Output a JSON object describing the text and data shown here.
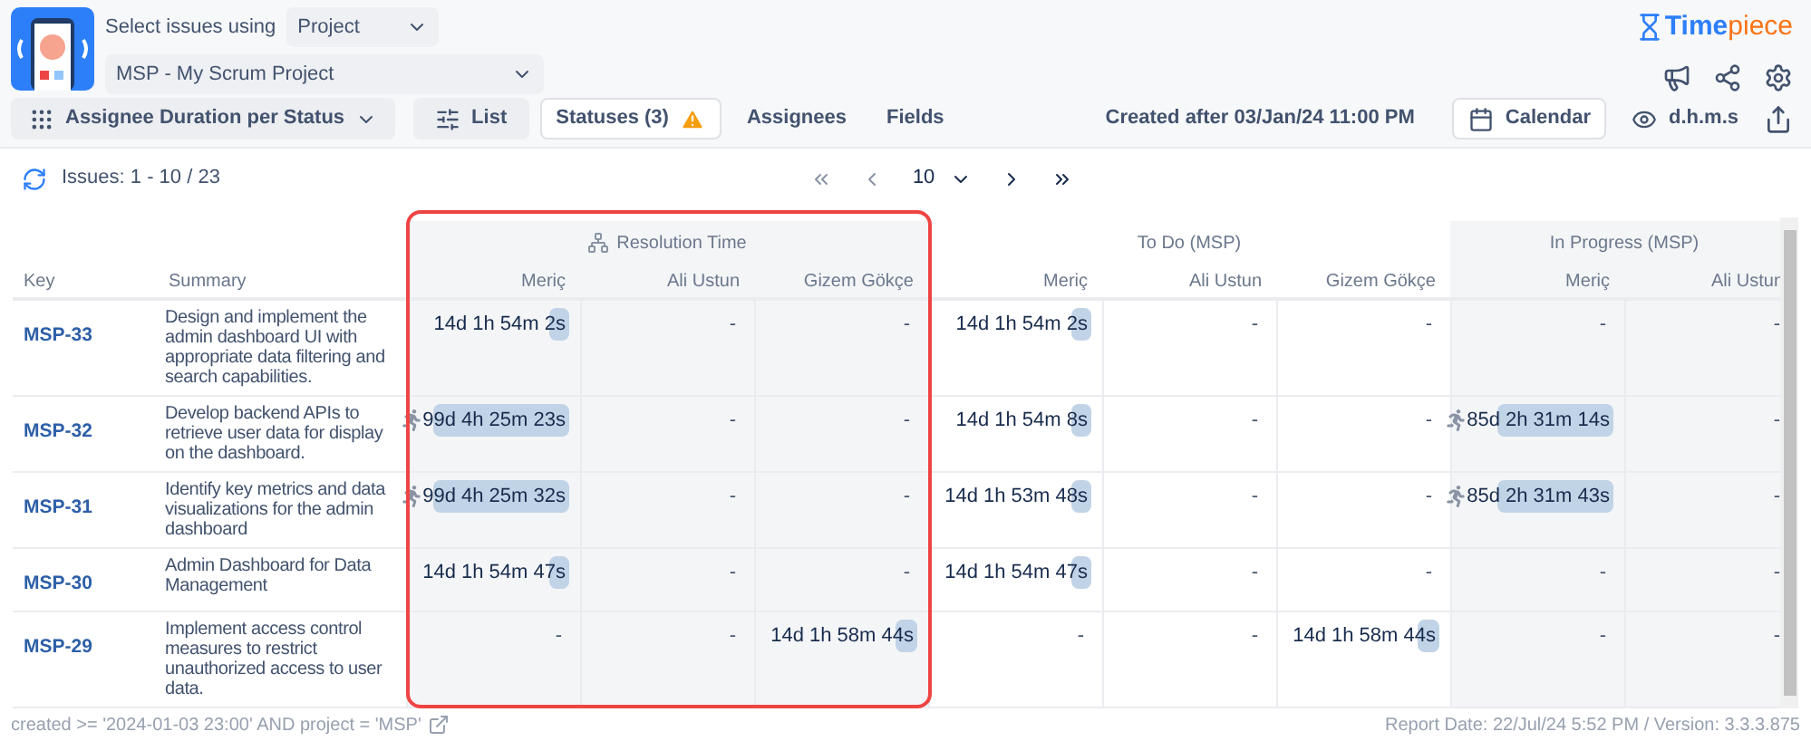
{
  "header": {
    "select_label": "Select issues using",
    "select_value": "Project",
    "project_value": "MSP - My Scrum Project",
    "brand": {
      "part_1": "Time",
      "part_2": "piece"
    }
  },
  "toolbar": {
    "report": "Assignee Duration per Status",
    "list": "List",
    "statuses": "Statuses (3)",
    "statuses_warning": true,
    "assignees": "Assignees",
    "fields": "Fields",
    "filter": "Created after 03/Jan/24 11:00 PM",
    "calendar": "Calendar",
    "format": "d.h.m.s"
  },
  "pager": {
    "issues": "Issues: 1 - 10 / 23",
    "page_size": "10"
  },
  "table": {
    "columns": [
      "Key",
      "Summary"
    ],
    "groups": [
      {
        "title": "Resolution Time",
        "kind": "aggregate",
        "highlighted": true,
        "assignees": [
          "Meriç",
          "Ali Ustun",
          "Gizem Gökçe"
        ]
      },
      {
        "title": "To Do (MSP)",
        "kind": "status",
        "highlighted": false,
        "assignees": [
          "Meriç",
          "Ali Ustun",
          "Gizem Gökçe"
        ]
      },
      {
        "title": "In Progress (MSP)",
        "kind": "status",
        "highlighted": false,
        "assignees": [
          "Meriç",
          "Ali Ustun"
        ]
      }
    ],
    "rows": [
      {
        "key": "MSP-33",
        "summary": "Design and implement the admin dashboard UI with appropriate data filtering and search capabilities.",
        "cells": [
          {
            "kind": "bar",
            "text": "14d 1h 54m 2s",
            "level": 0.13
          },
          {
            "kind": "plain",
            "text": "-"
          },
          {
            "kind": "plain",
            "text": "-"
          },
          {
            "kind": "bar",
            "text": "14d 1h 54m 2s",
            "level": 0.13
          },
          {
            "kind": "plain",
            "text": "-"
          },
          {
            "kind": "plain",
            "text": "-"
          },
          {
            "kind": "plain",
            "text": "-"
          },
          {
            "kind": "plain",
            "text": "-"
          }
        ]
      },
      {
        "key": "MSP-32",
        "summary": "Develop backend APIs to retrieve user data for display on the dashboard.",
        "cells": [
          {
            "kind": "runner",
            "text": "99d 4h 25m 23s",
            "level": 0.9
          },
          {
            "kind": "plain",
            "text": "-"
          },
          {
            "kind": "plain",
            "text": "-"
          },
          {
            "kind": "bar",
            "text": "14d 1h 54m 8s",
            "level": 0.13
          },
          {
            "kind": "plain",
            "text": "-"
          },
          {
            "kind": "plain",
            "text": "-"
          },
          {
            "kind": "runner",
            "text": "85d 2h 31m 14s",
            "level": 0.77
          },
          {
            "kind": "plain",
            "text": "-"
          }
        ]
      },
      {
        "key": "MSP-31",
        "summary": "Identify key metrics and data visualizations for the admin dashboard",
        "cells": [
          {
            "kind": "runner",
            "text": "99d 4h 25m 32s",
            "level": 0.9
          },
          {
            "kind": "plain",
            "text": "-"
          },
          {
            "kind": "plain",
            "text": "-"
          },
          {
            "kind": "bar",
            "text": "14d 1h 53m 48s",
            "level": 0.13
          },
          {
            "kind": "plain",
            "text": "-"
          },
          {
            "kind": "plain",
            "text": "-"
          },
          {
            "kind": "runner",
            "text": "85d 2h 31m 43s",
            "level": 0.77
          },
          {
            "kind": "plain",
            "text": "-"
          }
        ]
      },
      {
        "key": "MSP-30",
        "summary": "Admin Dashboard for Data Management",
        "cells": [
          {
            "kind": "bar",
            "text": "14d 1h 54m 47s",
            "level": 0.13
          },
          {
            "kind": "plain",
            "text": "-"
          },
          {
            "kind": "plain",
            "text": "-"
          },
          {
            "kind": "bar",
            "text": "14d 1h 54m 47s",
            "level": 0.13
          },
          {
            "kind": "plain",
            "text": "-"
          },
          {
            "kind": "plain",
            "text": "-"
          },
          {
            "kind": "plain",
            "text": "-"
          },
          {
            "kind": "plain",
            "text": "-"
          }
        ]
      },
      {
        "key": "MSP-29",
        "summary": "Implement access control measures to restrict unauthorized access to user data.",
        "cells": [
          {
            "kind": "plain",
            "text": "-"
          },
          {
            "kind": "plain",
            "text": "-"
          },
          {
            "kind": "bar",
            "text": "14d 1h 58m 44s",
            "level": 0.15
          },
          {
            "kind": "plain",
            "text": "-"
          },
          {
            "kind": "plain",
            "text": "-"
          },
          {
            "kind": "bar",
            "text": "14d 1h 58m 44s",
            "level": 0.15
          },
          {
            "kind": "plain",
            "text": "-"
          },
          {
            "kind": "plain",
            "text": "-"
          }
        ]
      }
    ]
  },
  "footer": {
    "query": "created >= '2024-01-03 23:00' AND project = 'MSP'",
    "report_info": "Report Date: 22/Jul/24 5:52 PM / Version: 3.3.3.875"
  }
}
